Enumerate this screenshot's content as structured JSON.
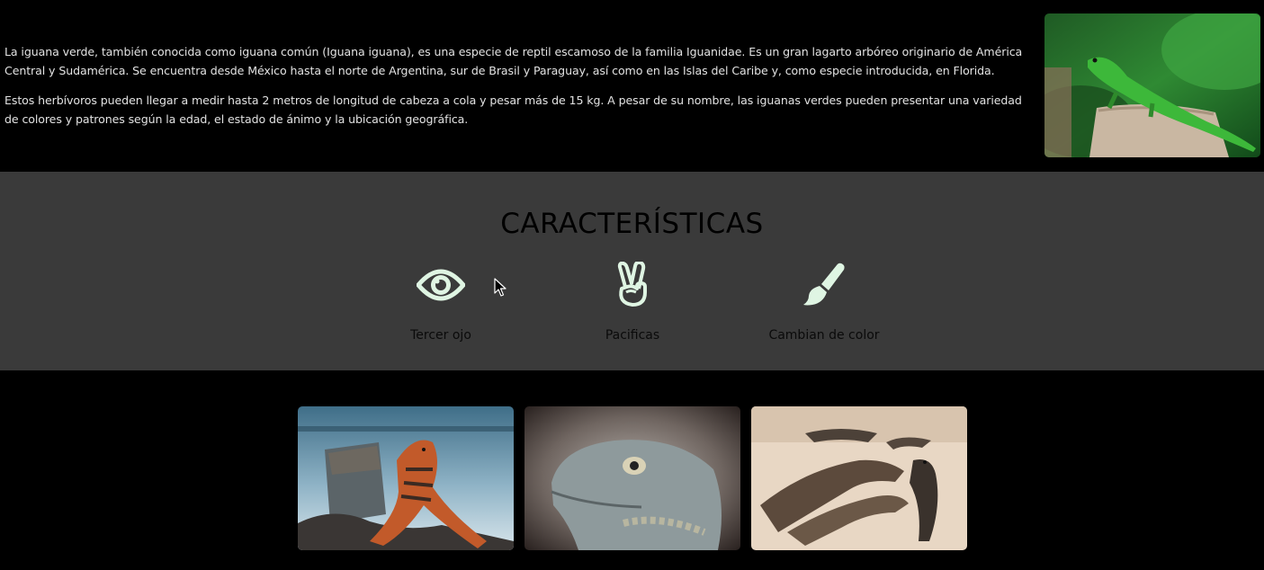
{
  "intro": {
    "paragraphs": [
      "La iguana verde, también conocida como iguana común (Iguana iguana), es una especie de reptil escamoso de la familia Iguanidae. Es un gran lagarto arbóreo originario de América Central y Sudamérica. Se encuentra desde México hasta el norte de Argentina, sur de Brasil y Paraguay, así como en las Islas del Caribe y, como especie introducida, en Florida.",
      "Estos herbívoros pueden llegar a medir hasta 2 metros de longitud de cabeza a cola y pesar más de 15 kg. A pesar de su nombre, las iguanas verdes pueden presentar una variedad de colores y patrones según la edad, el estado de ánimo y la ubicación geográfica."
    ]
  },
  "features": {
    "title": "CARACTERÍSTICAS",
    "items": [
      {
        "label": "Tercer ojo",
        "icon": "eye-icon"
      },
      {
        "label": "Pacificas",
        "icon": "peace-hand-icon"
      },
      {
        "label": "Cambian de color",
        "icon": "paintbrush-icon"
      }
    ]
  },
  "colors": {
    "icon": "#dff5e3",
    "features_bg": "#3a3a3a",
    "page_bg": "#000000"
  }
}
